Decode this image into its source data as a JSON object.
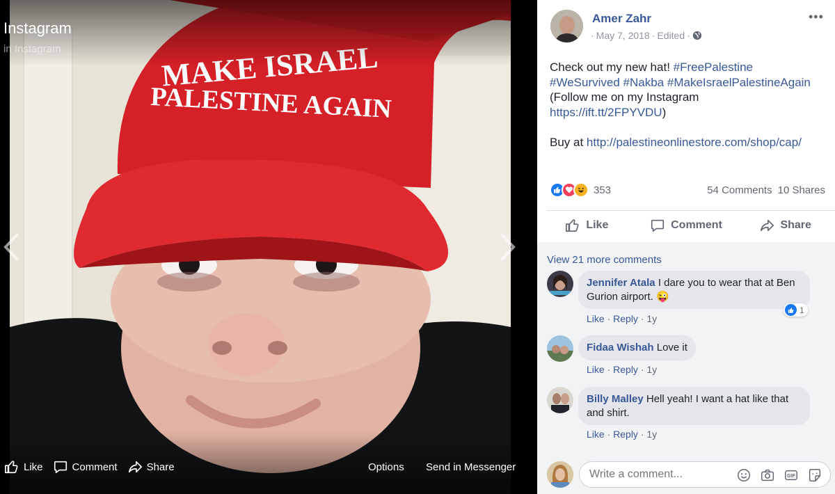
{
  "photo": {
    "album_title": "Instagram",
    "album_prefix": "in",
    "album_link": "Instagram",
    "hat_line_1": "MAKE ISRAEL",
    "hat_line_2": "PALESTINE AGAIN",
    "actions": {
      "like": "Like",
      "comment": "Comment",
      "share": "Share",
      "options": "Options",
      "send": "Send in Messenger"
    }
  },
  "post": {
    "author": "Amer Zahr",
    "date": "May 7, 2018",
    "edited": "Edited",
    "text_1": "Check out my new hat! ",
    "tag_1": "#FreePalestine",
    "tag_2": "#WeSurvived",
    "tag_3": "#Nakba",
    "tag_4": "#MakeIsraelPalestineAgain",
    "text_2": "(Follow me on my Instagram",
    "link_1": "https://ift.tt/2FPYVDU",
    "text_3": ")",
    "text_4": "Buy at ",
    "link_2": "http://palestineonlinestore.com/shop/cap/",
    "reaction_count": "353",
    "comments_count": "54 Comments",
    "shares_count": "10 Shares",
    "actions": {
      "like": "Like",
      "comment": "Comment",
      "share": "Share"
    }
  },
  "comments": {
    "view_more": "View 21 more comments",
    "items": [
      {
        "name": "Jennifer Atala",
        "text": "I dare you to wear that at Ben Gurion airport. 😜",
        "like": "Like",
        "reply": "Reply",
        "age": "1y",
        "reactions": "1"
      },
      {
        "name": "Fidaa Wishah",
        "text": "Love it",
        "like": "Like",
        "reply": "Reply",
        "age": "1y"
      },
      {
        "name": "Billy Malley",
        "text": "Hell yeah! I want a hat like that and shirt.",
        "like": "Like",
        "reply": "Reply",
        "age": "1y"
      }
    ]
  },
  "composer": {
    "placeholder": "Write a comment..."
  },
  "colors": {
    "link": "#385898",
    "hat_red": "#d42026",
    "text": "#1d2129",
    "muted": "#606770"
  }
}
